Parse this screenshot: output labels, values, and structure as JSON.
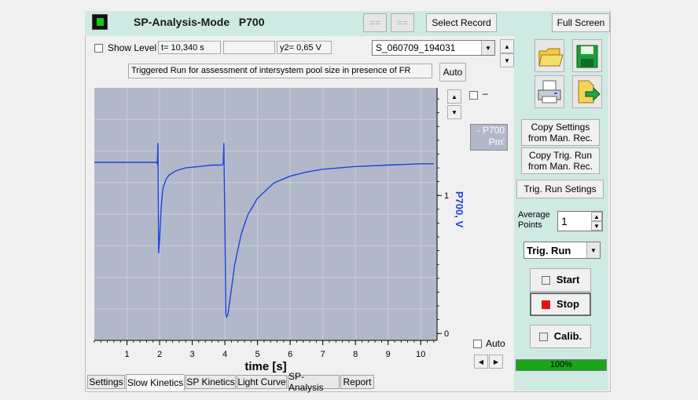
{
  "header": {
    "title": "SP-Analysis-Mode   P700",
    "btn_eq1": "==",
    "btn_eq2": "==",
    "select_record": "Select Record",
    "full_screen": "Full Screen"
  },
  "toolbar": {
    "show_level": "Show Level",
    "t_value": "t= 10,340 s",
    "mid_value": "",
    "y2_value": "y2= 0,65 V",
    "record": "S_060709_194031",
    "comment": "Triggered Run for assessment of intersystem pool size in presence of FR",
    "auto": "Auto"
  },
  "plot": {
    "legend_line": "P700",
    "legend_line2": "Pm'",
    "side_check_label": "–",
    "auto_label": "Auto",
    "colors": {
      "background": "#b1b8c9",
      "trace": "#1c44e0",
      "axis_label": "#1c44e0"
    }
  },
  "chart_data": {
    "type": "line",
    "xlabel": "time [s]",
    "ylabel": "P700, V",
    "xlim": [
      0,
      10.5
    ],
    "ylim": [
      -0.05,
      1.78
    ],
    "x_ticks": [
      1,
      2,
      3,
      4,
      5,
      6,
      7,
      8,
      9,
      10
    ],
    "y_ticks": [
      0,
      1
    ],
    "series": [
      {
        "name": "P700",
        "x": [
          0,
          0.5,
          1.0,
          1.5,
          1.8,
          1.9,
          1.93,
          1.95,
          1.97,
          2.0,
          2.05,
          2.1,
          2.2,
          2.3,
          2.5,
          2.8,
          3.2,
          3.6,
          3.9,
          3.95,
          3.97,
          4.0,
          4.03,
          4.05,
          4.08,
          4.1,
          4.2,
          4.3,
          4.5,
          4.7,
          5.0,
          5.5,
          6.0,
          6.5,
          7.0,
          7.5,
          8.0,
          9.0,
          10.0,
          10.4
        ],
        "y": [
          1.24,
          1.24,
          1.24,
          1.24,
          1.24,
          1.24,
          1.23,
          1.38,
          0.58,
          0.68,
          0.92,
          1.05,
          1.12,
          1.15,
          1.18,
          1.2,
          1.21,
          1.22,
          1.22,
          1.23,
          1.38,
          0.78,
          0.14,
          0.12,
          0.13,
          0.15,
          0.32,
          0.5,
          0.72,
          0.86,
          0.98,
          1.09,
          1.14,
          1.17,
          1.19,
          1.2,
          1.21,
          1.22,
          1.23,
          1.23
        ]
      }
    ]
  },
  "right_panel": {
    "copy_settings": "Copy Settings from Man. Rec.",
    "copy_trig": "Copy Trig. Run from Man. Rec.",
    "trig_settings": "Trig. Run Setings",
    "avg_label": "Average Points",
    "avg_value": "1",
    "mode_value": "Trig. Run",
    "start": "Start",
    "stop": "Stop",
    "calib": "Calib.",
    "progress_value": "100%",
    "progress_fraction": 1.0,
    "icons": [
      "open-folder-icon",
      "save-disk-icon",
      "printer-icon",
      "export-icon"
    ]
  },
  "tabs": [
    {
      "label": "Settings"
    },
    {
      "label": "Slow Kinetics"
    },
    {
      "label": "SP Kinetics"
    },
    {
      "label": "Light Curve"
    },
    {
      "label": "SP-Analysis"
    },
    {
      "label": "Report"
    }
  ]
}
